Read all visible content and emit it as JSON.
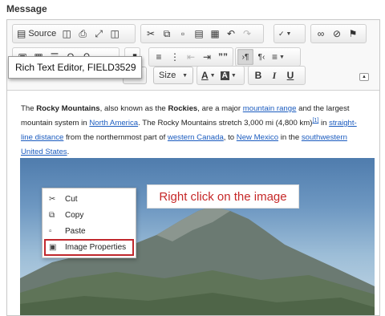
{
  "field_label": "Message",
  "toolbar": {
    "source_label": "Source",
    "font_placeholder": "",
    "size_label": "Size"
  },
  "tooltip": "Rich Text Editor, FIELD3529",
  "paragraph": {
    "s1": "The ",
    "b1": "Rocky Mountains",
    "s2": ", also known as the ",
    "b2": "Rockies",
    "s3": ", are a major ",
    "l1": "mountain range",
    "s4": " and the largest mountain system in ",
    "l2": "North America",
    "s5": ". The Rocky Mountains stretch 3,000 mi (4,800 km)",
    "sup": "[1]",
    "s6": " in ",
    "l3": "straight-line distance",
    "s7": " from the northernmost part of ",
    "l4": "western Canada",
    "s8": ", to ",
    "l5": "New Mexico",
    "s9": " in the ",
    "l6": "southwestern United States",
    "s10": "."
  },
  "context_menu": {
    "items": [
      {
        "label": "Cut",
        "icon": "scissors-icon"
      },
      {
        "label": "Copy",
        "icon": "copy-icon"
      },
      {
        "label": "Paste",
        "icon": "paste-icon"
      },
      {
        "label": "Image Properties",
        "icon": "image-icon"
      }
    ]
  },
  "annotation": "Right click on the image",
  "colors": {
    "link": "#1a5bbf",
    "highlight": "#c0282d",
    "annotation": "#c62828"
  }
}
